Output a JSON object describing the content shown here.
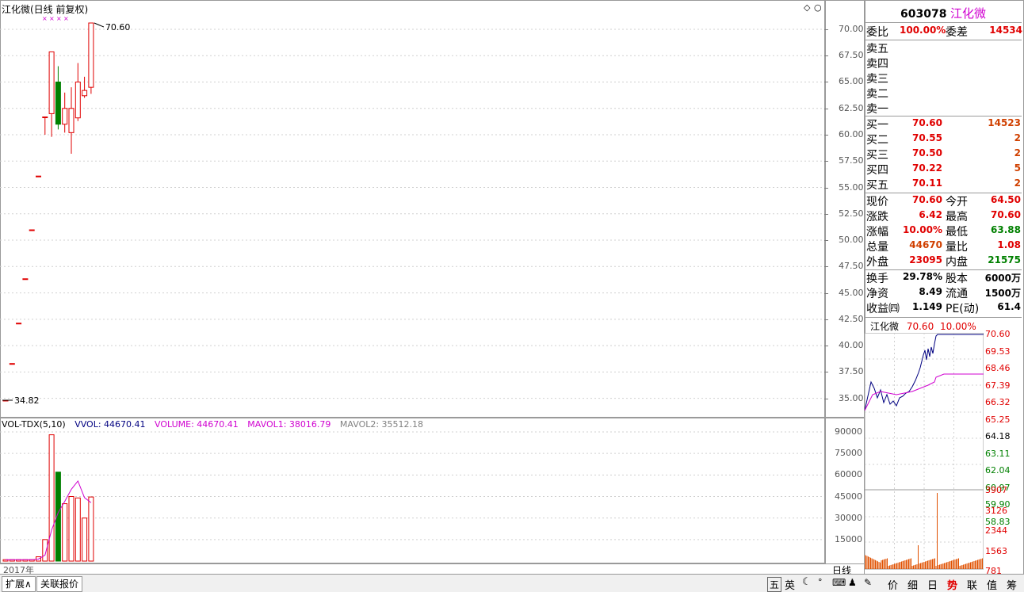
{
  "chart_title": "江化微(日线 前复权)",
  "price_high_label": "70.60",
  "price_low_label": "34.82",
  "price_ticks": [
    "70.00",
    "67.50",
    "65.00",
    "62.50",
    "60.00",
    "57.50",
    "55.00",
    "52.50",
    "50.00",
    "47.50",
    "45.00",
    "42.50",
    "40.00",
    "37.50",
    "35.00"
  ],
  "volume_legend": {
    "name": "VOL-TDX(5,10)",
    "vvol": "VVOL: 44670.41",
    "volume": "VOLUME: 44670.41",
    "mavol1": "MAVOL1: 38016.79",
    "mavol2": "MAVOL2: 35512.18"
  },
  "volume_ticks": [
    "90000",
    "75000",
    "60000",
    "45000",
    "30000",
    "15000"
  ],
  "year_label": "2017年",
  "period_label": "日线",
  "stock": {
    "code": "603078",
    "name": "江化微"
  },
  "order_ratio": {
    "label1": "委比",
    "value1": "100.00%",
    "label2": "委差",
    "value2": "14534"
  },
  "sell_levels": [
    {
      "label": "卖五"
    },
    {
      "label": "卖四"
    },
    {
      "label": "卖三"
    },
    {
      "label": "卖二"
    },
    {
      "label": "卖一"
    }
  ],
  "buy_levels": [
    {
      "label": "买一",
      "price": "70.60",
      "vol": "14523"
    },
    {
      "label": "买二",
      "price": "70.55",
      "vol": "2"
    },
    {
      "label": "买三",
      "price": "70.50",
      "vol": "2"
    },
    {
      "label": "买四",
      "price": "70.22",
      "vol": "5"
    },
    {
      "label": "买五",
      "price": "70.11",
      "vol": "2"
    }
  ],
  "stats": [
    {
      "l1": "现价",
      "v1": "70.60",
      "l2": "今开",
      "v2": "64.50"
    },
    {
      "l1": "涨跌",
      "v1": "6.42",
      "l2": "最高",
      "v2": "70.60"
    },
    {
      "l1": "涨幅",
      "v1": "10.00%",
      "l2": "最低",
      "v2": "63.88"
    },
    {
      "l1": "总量",
      "v1": "44670",
      "l2": "量比",
      "v2": "1.08"
    },
    {
      "l1": "外盘",
      "v1": "23095",
      "l2": "内盘",
      "v2": "21575"
    }
  ],
  "stats2": [
    {
      "l1": "换手",
      "v1": "29.78%",
      "l2": "股本",
      "v2": "6000万"
    },
    {
      "l1": "净资",
      "v1": "8.49",
      "l2": "流通",
      "v2": "1500万"
    },
    {
      "l1": "收益㈣",
      "v1": "1.149",
      "l2": "PE(动)",
      "v2": "61.4"
    }
  ],
  "mini_header": {
    "name": "江化微",
    "price": "70.60",
    "pct": "10.00%"
  },
  "mini_price_ticks": [
    "70.60",
    "69.53",
    "68.46",
    "67.39",
    "66.32",
    "65.25",
    "64.18",
    "63.11",
    "62.04",
    "60.97",
    "59.90",
    "58.83"
  ],
  "mini_vol_ticks": [
    "3907",
    "3126",
    "2344",
    "1563",
    "781"
  ],
  "bottom_tabs": [
    "扩展∧",
    "关联报价"
  ],
  "right_tabs": [
    "价",
    "细",
    "日",
    "势",
    "联",
    "值",
    "筹"
  ],
  "toolbar_icons": [
    "五",
    "英"
  ],
  "colors": {
    "up": "#e00000",
    "down": "#008000",
    "ma": "#d000d0",
    "price_line": "#000080"
  },
  "chart_data": {
    "type": "candlestick",
    "title": "江化微(日线 前复权)",
    "ylim": [
      34.82,
      70.6
    ],
    "candles": [
      {
        "open": 34.82,
        "close": 34.82,
        "high": 34.82,
        "low": 34.82,
        "volume": 1000
      },
      {
        "open": 38.3,
        "close": 38.3,
        "high": 38.3,
        "low": 38.3,
        "volume": 1000
      },
      {
        "open": 42.13,
        "close": 42.13,
        "high": 42.13,
        "low": 42.13,
        "volume": 1000
      },
      {
        "open": 46.34,
        "close": 46.34,
        "high": 46.34,
        "low": 46.34,
        "volume": 1000
      },
      {
        "open": 50.98,
        "close": 50.98,
        "high": 50.98,
        "low": 50.98,
        "volume": 1000
      },
      {
        "open": 56.08,
        "close": 56.08,
        "high": 56.08,
        "low": 56.08,
        "volume": 3000
      },
      {
        "open": 61.69,
        "close": 61.69,
        "high": 61.69,
        "low": 60.0,
        "volume": 15000
      },
      {
        "open": 62.0,
        "close": 67.86,
        "high": 67.86,
        "low": 59.8,
        "volume": 88000
      },
      {
        "open": 65.0,
        "close": 61.0,
        "high": 66.5,
        "low": 60.5,
        "volume": 62000
      },
      {
        "open": 61.0,
        "close": 62.5,
        "high": 64.0,
        "low": 60.2,
        "volume": 40000
      },
      {
        "open": 60.2,
        "close": 62.5,
        "high": 64.5,
        "low": 58.2,
        "volume": 45000
      },
      {
        "open": 61.6,
        "close": 65.0,
        "high": 66.8,
        "low": 61.3,
        "volume": 44000
      },
      {
        "open": 63.7,
        "close": 64.2,
        "high": 65.5,
        "low": 63.5,
        "volume": 30000
      },
      {
        "open": 64.5,
        "close": 70.6,
        "high": 70.6,
        "low": 63.88,
        "volume": 44670
      }
    ]
  }
}
